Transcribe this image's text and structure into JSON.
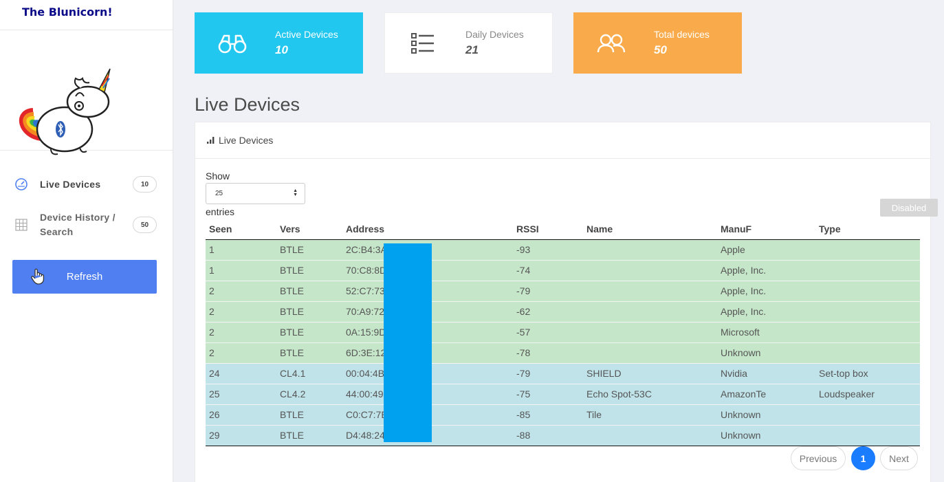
{
  "app": {
    "title": "The Blunicorn!"
  },
  "sidebar": {
    "items": [
      {
        "label": "Live Devices",
        "badge": "10",
        "icon": "dashboard-gauge-icon"
      },
      {
        "label": "Device History / Search",
        "badge": "50",
        "icon": "grid-icon"
      }
    ],
    "refresh_label": "Refresh"
  },
  "cards": {
    "active": {
      "label": "Active Devices",
      "value": "10",
      "icon": "binoculars-icon",
      "color": "#21c7ee"
    },
    "daily": {
      "label": "Daily Devices",
      "value": "21",
      "icon": "list-icon",
      "color": "#ffffff"
    },
    "total": {
      "label": "Total devices",
      "value": "50",
      "icon": "users-icon",
      "color": "#f9ab4b"
    }
  },
  "main": {
    "title": "Live Devices",
    "panel_title": "Live Devices",
    "show_label": "Show",
    "page_size": "25",
    "entries_label": "entries",
    "disabled_label": "Disabled"
  },
  "table": {
    "headers": [
      "Seen",
      "Vers",
      "Address",
      "RSSI",
      "Name",
      "ManuF",
      "Type"
    ],
    "rows": [
      {
        "seen": "1",
        "vers": "BTLE",
        "address": "2C:B4:3A",
        "rssi": "-93",
        "name": "",
        "manuf": "Apple",
        "type": "",
        "status": "green"
      },
      {
        "seen": "1",
        "vers": "BTLE",
        "address": "70:C8:8D",
        "rssi": "-74",
        "name": "",
        "manuf": "Apple, Inc.",
        "type": "",
        "status": "green"
      },
      {
        "seen": "2",
        "vers": "BTLE",
        "address": "52:C7:73",
        "rssi": "-79",
        "name": "",
        "manuf": "Apple, Inc.",
        "type": "",
        "status": "green"
      },
      {
        "seen": "2",
        "vers": "BTLE",
        "address": "70:A9:72",
        "rssi": "-62",
        "name": "",
        "manuf": "Apple, Inc.",
        "type": "",
        "status": "green"
      },
      {
        "seen": "2",
        "vers": "BTLE",
        "address": "0A:15:9D",
        "rssi": "-57",
        "name": "",
        "manuf": "Microsoft",
        "type": "",
        "status": "green"
      },
      {
        "seen": "2",
        "vers": "BTLE",
        "address": "6D:3E:12",
        "rssi": "-78",
        "name": "",
        "manuf": "Unknown",
        "type": "",
        "status": "green"
      },
      {
        "seen": "24",
        "vers": "CL4.1",
        "address": "00:04:4B",
        "rssi": "-79",
        "name": "SHIELD",
        "manuf": "Nvidia",
        "type": "Set-top box",
        "status": "blue"
      },
      {
        "seen": "25",
        "vers": "CL4.2",
        "address": "44:00:49",
        "rssi": "-75",
        "name": "Echo Spot-53C",
        "manuf": "AmazonTe",
        "type": "Loudspeaker",
        "status": "blue"
      },
      {
        "seen": "26",
        "vers": "BTLE",
        "address": "C0:C7:7E",
        "rssi": "-85",
        "name": "Tile",
        "manuf": "Unknown",
        "type": "",
        "status": "blue"
      },
      {
        "seen": "29",
        "vers": "BTLE",
        "address": "D4:48:24",
        "rssi": "-88",
        "name": "",
        "manuf": "Unknown",
        "type": "",
        "status": "blue"
      }
    ],
    "row_colors": {
      "green": "#c5e6c9",
      "blue": "#bfe3e9"
    },
    "redaction_color": "#00a2ef"
  },
  "pagination": {
    "previous": "Previous",
    "current": "1",
    "next": "Next"
  }
}
